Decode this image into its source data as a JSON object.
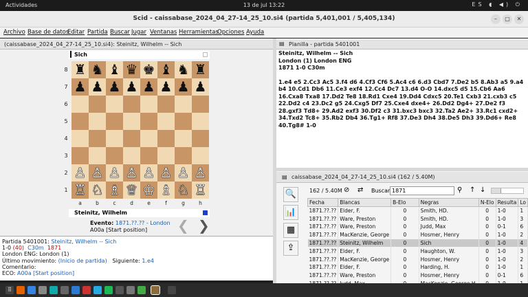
{
  "topbar": {
    "activities": "Actividades",
    "clock": "13 de jul  13:22",
    "tray": "ES ◖ ◀) ⏻"
  },
  "window": {
    "title": "Scid - caissabase_2024_04_27-14_25_10.si4 (partida 5,401,001 / 5,405,134)",
    "min": "–",
    "max": "▢",
    "close": "✕"
  },
  "menu": [
    "Archivo",
    "Base de datos",
    "Editar",
    "Partida",
    "Buscar",
    "Jugar",
    "Ventanas",
    "Herramientas",
    "Opciones",
    "Ayuda"
  ],
  "board_tab": {
    "label": "(caissabase_2024_04_27-14_25_10.si4): Steinitz, Wilhelm  --  Sich"
  },
  "board": {
    "top_player": "Sich",
    "bottom_player": "Steinitz, Wilhelm",
    "ranks": [
      "8",
      "7",
      "6",
      "5",
      "4",
      "3",
      "2",
      "1"
    ],
    "files": [
      "a",
      "b",
      "c",
      "d",
      "e",
      "f",
      "g",
      "h"
    ],
    "pieces": {
      "rank8": [
        "♜",
        "♞",
        "♝",
        "♛",
        "♚",
        "♝",
        "♞",
        "♜"
      ],
      "rank7": [
        "♟",
        "♟",
        "♟",
        "♟",
        "♟",
        "♟",
        "♟",
        "♟"
      ],
      "rank2": [
        "♙",
        "♙",
        "♙",
        "♙",
        "♙",
        "♙",
        "♙",
        "♙"
      ],
      "rank1": [
        "♖",
        "♘",
        "♗",
        "♕",
        "♔",
        "♗",
        "♘",
        "♖"
      ]
    },
    "event_label": "Evento:",
    "event_value": "1871.??.?? - London",
    "opening": "A00a [Start position]",
    "prev": "❮",
    "next": "❯"
  },
  "info": {
    "line1_label": "Partida 5401001:",
    "line1_players": "Steinitz, Wilhelm  --  Sich",
    "line2_result": "1-0",
    "line2_ply": "(40)",
    "line2_eco": "C30m",
    "line2_year": "1871",
    "line3": "London ENG:  London (1)",
    "line4_label": "Último movimiento:",
    "line4_value": "(Inicio de partida)",
    "line4_next_label": "Siguiente:",
    "line4_next": "1.e4",
    "line5": "Comentario:",
    "line6_label": "ECO:",
    "line6_value": "A00a [Start position]"
  },
  "notation_tab": {
    "label": "Planilla - partida 5401001"
  },
  "notation": {
    "header1": "Steinitz, Wilhelm   --   Sich",
    "header2": "London (1)  London ENG",
    "header3": "1871  1-0  C30m",
    "moves": "1.e4 e5 2.Cc3 Ac5 3.f4 d6 4.Cf3 Cf6 5.Ac4 c6 6.d3 Cbd7 7.De2 b5 8.Ab3 a5 9.a4 b4 10.Cd1 Db6 11.Ce3 exf4 12.Cc4 Dc7 13.d4 O-O 14.dxc5 d5 15.Cb6 Aa6 16.Cxa8 Txa8 17.Dd2 Te8 18.Rd1 Cxe4 19.Dd4 Cdxc5 20.Te1 Cxb3 21.cxb3 c5 22.Dd2 c4 23.Dc2 g5 24.Cxg5 Df7 25.Cxe4 dxe4+ 26.Dd2 Dg4+ 27.De2 f3 28.gxf3 Td8+ 29.Ad2 exf3 30.Df2 c3 31.bxc3 bxc3 32.Ta2 Ae2+ 33.Rc1 cxd2+ 34.Txd2 Tc8+ 35.Rb2 Db4 36.Tg1+ Rf8 37.De3 Dh4 38.De5 Dh3 39.Dd6+ Re8 40.Tg8# 1-0"
  },
  "list_tab": {
    "label": "caissabase_2024_04_27-14_25_10.si4 (162 / 5.40M)"
  },
  "list_toolbar": {
    "count": "162 / 5.40M",
    "search_label": "Buscar",
    "search_value": "1871"
  },
  "games_table": {
    "columns": [
      "Fecha",
      "Blancas",
      "B-Elo",
      "Negras",
      "N-Elo",
      "Resulta",
      "Lo"
    ],
    "rows": [
      [
        "1871.??.??",
        "Elder, F.",
        "0",
        "Smith, HD.",
        "0",
        "1-0",
        "1"
      ],
      [
        "1871.??.??",
        "Ware, Preston",
        "0",
        "Smith, HD.",
        "0",
        "1-0",
        "3"
      ],
      [
        "1871.??.??",
        "Ware, Preston",
        "0",
        "Judd, Max",
        "0",
        "0-1",
        "6"
      ],
      [
        "1871.??.??",
        "MacKenzie, George",
        "0",
        "Hosmer, Henry",
        "0",
        "1-0",
        "2"
      ],
      [
        "1871.??.??",
        "Steinitz, Wilhelm",
        "0",
        "Sich",
        "0",
        "1-0",
        "4"
      ],
      [
        "1871.??.??",
        "Elder, F.",
        "0",
        "Haughton, W.",
        "0",
        "1-0",
        "3"
      ],
      [
        "1871.??.??",
        "MacKenzie, George",
        "0",
        "Hosmer, Henry",
        "0",
        "1-0",
        "2"
      ],
      [
        "1871.??.??",
        "Elder, F.",
        "0",
        "Harding, H.",
        "0",
        "1-0",
        "1"
      ],
      [
        "1871.??.??",
        "Ware, Preston",
        "0",
        "Hosmer, Henry",
        "0",
        "0-1",
        "6"
      ],
      [
        "1871.??.??",
        "Judd, Max",
        "0",
        "MacKenzie, George H",
        "0",
        "1-0",
        "1"
      ]
    ],
    "selected_index": 4
  },
  "colors": {
    "light_square": "#f1d9b4",
    "dark_square": "#c89566",
    "link": "#1a5fb4",
    "selected_row": "#c9c9c9"
  }
}
